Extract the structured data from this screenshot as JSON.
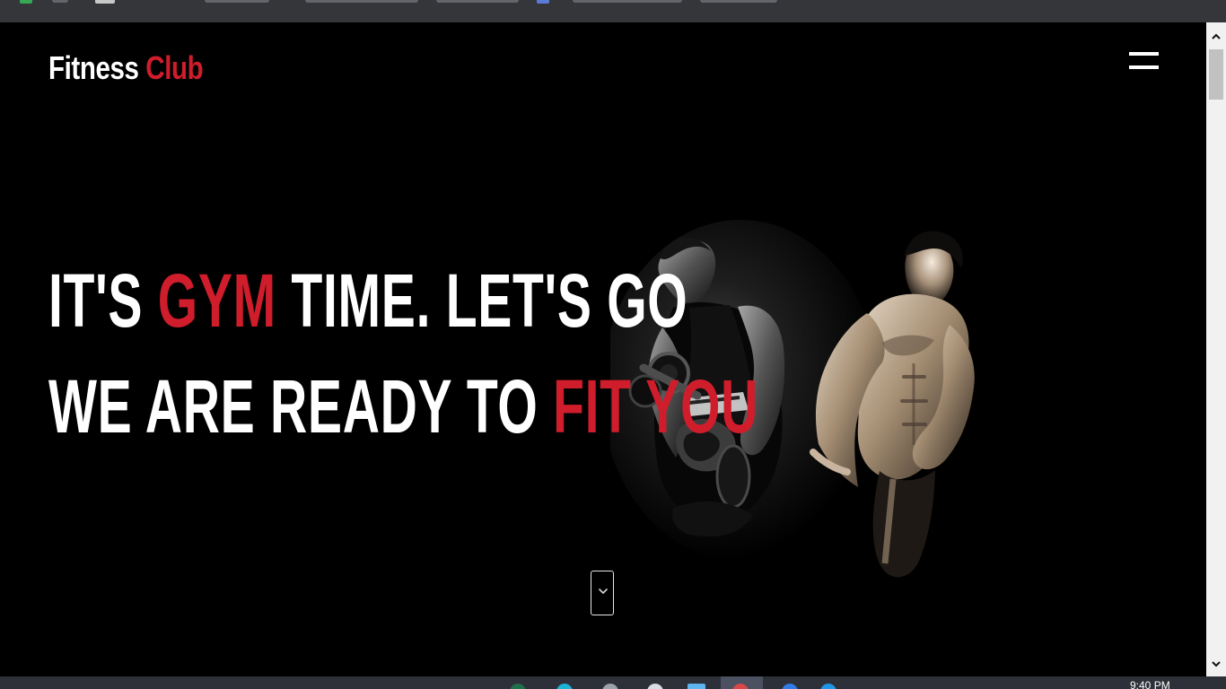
{
  "site": {
    "logo": {
      "primary": "Fitness",
      "accent": "Club"
    },
    "menu_icon": "hamburger-menu-icon",
    "hero": {
      "line1": {
        "before": "IT'S",
        "accent": "GYM",
        "after": "TIME. LET'S GO"
      },
      "line2": {
        "before": "WE ARE READY TO",
        "accent": "FIT YOU"
      },
      "image": "two-gym-men-photo",
      "scroll_icon": "chevron-down-icon"
    }
  },
  "taskbar": {
    "clock": "9:40 PM"
  },
  "colors": {
    "page_background": "#000000",
    "headline_text": "#ffffff",
    "brand_accent": "#cf1d2c",
    "browser_chrome": "#35363a",
    "scrollbar_track": "#f1f1f1",
    "scrollbar_thumb": "#c1c1c1",
    "taskbar": "#2d3038"
  }
}
